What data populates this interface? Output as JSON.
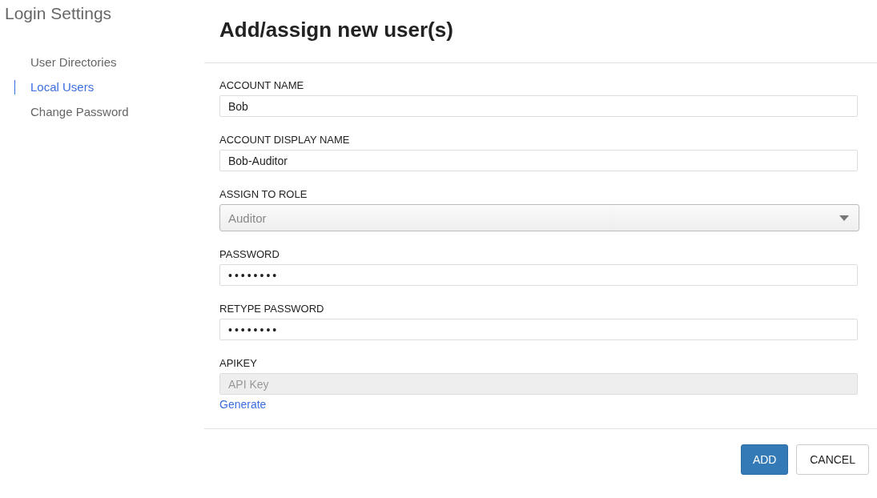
{
  "sidebar": {
    "title": "Login Settings",
    "items": [
      {
        "label": "User Directories",
        "selected": false
      },
      {
        "label": "Local Users",
        "selected": true
      },
      {
        "label": "Change Password",
        "selected": false
      }
    ]
  },
  "dialog": {
    "title": "Add/assign new user(s)",
    "fields": [
      {
        "kind": "text",
        "label": "ACCOUNT NAME",
        "value": "Bob"
      },
      {
        "kind": "text",
        "label": "ACCOUNT DISPLAY NAME",
        "value": "Bob-Auditor"
      },
      {
        "kind": "select",
        "label": "ASSIGN TO ROLE",
        "value": "Auditor"
      },
      {
        "kind": "password",
        "label": "PASSWORD",
        "value": "••••••••"
      },
      {
        "kind": "password",
        "label": "RETYPE PASSWORD",
        "value": "••••••••"
      },
      {
        "kind": "disabled",
        "label": "APIKEY",
        "placeholder": "API Key",
        "link": "Generate"
      }
    ],
    "buttons": [
      {
        "label": "ADD",
        "kind": "primary"
      },
      {
        "label": "CANCEL",
        "kind": "secondary"
      }
    ]
  }
}
